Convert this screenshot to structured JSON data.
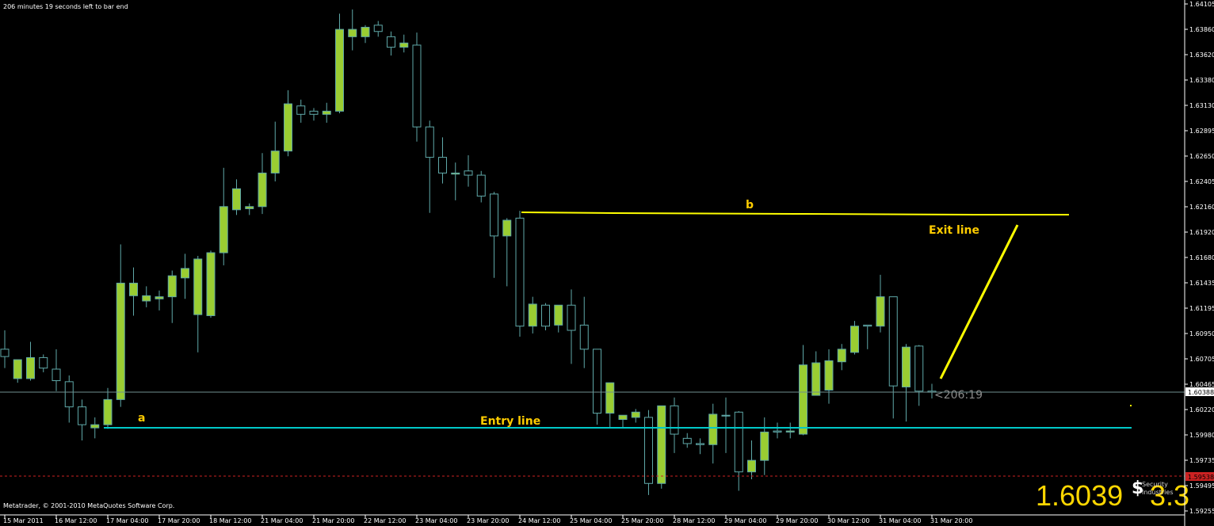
{
  "header": {
    "bar_timer": "206 minutes 19 seconds left to bar end"
  },
  "footer": {
    "copyright": "Metatrader, © 2001-2010 MetaQuotes Software Corp."
  },
  "colors": {
    "background": "#000000",
    "bull_fill": "#9acd32",
    "bear_fill": "#000000",
    "candle_outline": "#5fa8a8",
    "entry_line": "#00c8c8",
    "exit_line": "#ffff00",
    "annotation_text": "#ffcc00",
    "bid_line": "#6f8f8f",
    "lower_dashed": "#cc2222",
    "axis": "#ffffff"
  },
  "chart_data": {
    "type": "candlestick",
    "ylim": [
      1.5925,
      1.641
    ],
    "y_ticks": [
      "1.64105",
      "1.63860",
      "1.63620",
      "1.63380",
      "1.63130",
      "1.62895",
      "1.62650",
      "1.62405",
      "1.62160",
      "1.61920",
      "1.61680",
      "1.61435",
      "1.61195",
      "1.60950",
      "1.60705",
      "1.60465",
      "1.60220",
      "1.59980",
      "1.59735",
      "1.59495",
      "1.59255"
    ],
    "x_ticks": [
      {
        "label": "15 Mar 2011",
        "bar": 0
      },
      {
        "label": "16 Mar 12:00",
        "bar": 4
      },
      {
        "label": "17 Mar 04:00",
        "bar": 8
      },
      {
        "label": "17 Mar 20:00",
        "bar": 12
      },
      {
        "label": "18 Mar 12:00",
        "bar": 16
      },
      {
        "label": "21 Mar 04:00",
        "bar": 20
      },
      {
        "label": "21 Mar 20:00",
        "bar": 24
      },
      {
        "label": "22 Mar 12:00",
        "bar": 28
      },
      {
        "label": "23 Mar 04:00",
        "bar": 32
      },
      {
        "label": "23 Mar 20:00",
        "bar": 36
      },
      {
        "label": "24 Mar 12:00",
        "bar": 40
      },
      {
        "label": "25 Mar 04:00",
        "bar": 44
      },
      {
        "label": "25 Mar 20:00",
        "bar": 48
      },
      {
        "label": "28 Mar 12:00",
        "bar": 52
      },
      {
        "label": "29 Mar 04:00",
        "bar": 56
      },
      {
        "label": "29 Mar 20:00",
        "bar": 60
      },
      {
        "label": "30 Mar 12:00",
        "bar": 64
      },
      {
        "label": "31 Mar 04:00",
        "bar": 68
      },
      {
        "label": "31 Mar 20:00",
        "bar": 72
      }
    ],
    "ohlc": [
      [
        1.608,
        1.6098,
        1.6062,
        1.6073
      ],
      [
        1.6052,
        1.6068,
        1.6048,
        1.607
      ],
      [
        1.6052,
        1.6087,
        1.605,
        1.6072
      ],
      [
        1.6072,
        1.6075,
        1.6058,
        1.6062
      ],
      [
        1.6061,
        1.608,
        1.604,
        1.605
      ],
      [
        1.6049,
        1.6055,
        1.601,
        1.6025
      ],
      [
        1.6025,
        1.6032,
        1.5993,
        1.6008
      ],
      [
        1.6005,
        1.6015,
        1.5995,
        1.6008
      ],
      [
        1.6008,
        1.6043,
        1.6004,
        1.6032
      ],
      [
        1.6032,
        1.618,
        1.6025,
        1.6143
      ],
      [
        1.6131,
        1.6158,
        1.6112,
        1.6143
      ],
      [
        1.6126,
        1.614,
        1.612,
        1.6131
      ],
      [
        1.6128,
        1.6136,
        1.6117,
        1.613
      ],
      [
        1.613,
        1.6155,
        1.6105,
        1.615
      ],
      [
        1.6148,
        1.6171,
        1.6128,
        1.6157
      ],
      [
        1.6113,
        1.6169,
        1.6077,
        1.6166
      ],
      [
        1.6112,
        1.6174,
        1.611,
        1.6172
      ],
      [
        1.6172,
        1.6253,
        1.616,
        1.6216
      ],
      [
        1.6213,
        1.6242,
        1.6208,
        1.6233
      ],
      [
        1.6214,
        1.6219,
        1.6208,
        1.6216
      ],
      [
        1.6216,
        1.6267,
        1.6209,
        1.6248
      ],
      [
        1.6248,
        1.6297,
        1.624,
        1.6269
      ],
      [
        1.6269,
        1.6327,
        1.6264,
        1.6314
      ],
      [
        1.6312,
        1.6318,
        1.6296,
        1.6304
      ],
      [
        1.6307,
        1.631,
        1.6298,
        1.6304
      ],
      [
        1.6304,
        1.6315,
        1.6296,
        1.6307
      ],
      [
        1.6307,
        1.64,
        1.6305,
        1.6385
      ],
      [
        1.6378,
        1.6404,
        1.6365,
        1.6385
      ],
      [
        1.6378,
        1.6389,
        1.6372,
        1.6387
      ],
      [
        1.6389,
        1.6393,
        1.6378,
        1.6383
      ],
      [
        1.6378,
        1.6383,
        1.636,
        1.6368
      ],
      [
        1.6368,
        1.638,
        1.6363,
        1.6372
      ],
      [
        1.637,
        1.6382,
        1.6278,
        1.6292
      ],
      [
        1.6292,
        1.6298,
        1.621,
        1.6263
      ],
      [
        1.6263,
        1.6282,
        1.6238,
        1.6248
      ],
      [
        1.6247,
        1.6258,
        1.6222,
        1.6248
      ],
      [
        1.625,
        1.6265,
        1.6235,
        1.6246
      ],
      [
        1.6246,
        1.625,
        1.622,
        1.6226
      ],
      [
        1.6228,
        1.623,
        1.6148,
        1.6188
      ],
      [
        1.6188,
        1.6205,
        1.614,
        1.6203
      ],
      [
        1.6205,
        1.6212,
        1.6092,
        1.6102
      ],
      [
        1.6102,
        1.613,
        1.6095,
        1.6123
      ],
      [
        1.6122,
        1.6124,
        1.6098,
        1.6102
      ],
      [
        1.6103,
        1.612,
        1.6096,
        1.6122
      ],
      [
        1.6122,
        1.6137,
        1.6066,
        1.6098
      ],
      [
        1.6103,
        1.613,
        1.6062,
        1.608
      ],
      [
        1.608,
        1.608,
        1.6008,
        1.6019
      ],
      [
        1.6019,
        1.6046,
        1.6005,
        1.6048
      ],
      [
        1.6013,
        1.6015,
        1.6005,
        1.6017
      ],
      [
        1.6015,
        1.6023,
        1.601,
        1.602
      ],
      [
        1.6015,
        1.6022,
        1.5941,
        1.5952
      ],
      [
        1.5952,
        1.6026,
        1.5947,
        1.6026
      ],
      [
        1.6026,
        1.6034,
        1.5981,
        1.5999
      ],
      [
        1.5995,
        1.6,
        1.5986,
        1.599
      ],
      [
        1.599,
        1.5995,
        1.598,
        1.5989
      ],
      [
        1.5989,
        1.6028,
        1.5971,
        1.6018
      ],
      [
        1.6017,
        1.6034,
        1.5981,
        1.6017
      ],
      [
        1.602,
        1.6021,
        1.5945,
        1.5963
      ],
      [
        1.5963,
        1.5993,
        1.5956,
        1.5974
      ],
      [
        1.5974,
        1.6015,
        1.596,
        1.6001
      ],
      [
        1.6002,
        1.601,
        1.5995,
        1.6001
      ],
      [
        1.6001,
        1.601,
        1.5995,
        1.6002
      ],
      [
        1.5999,
        1.6084,
        1.5998,
        1.6065
      ],
      [
        1.6036,
        1.6078,
        1.6036,
        1.6067
      ],
      [
        1.6041,
        1.608,
        1.6028,
        1.6069
      ],
      [
        1.6068,
        1.6085,
        1.606,
        1.608
      ],
      [
        1.6077,
        1.6107,
        1.6075,
        1.6102
      ],
      [
        1.6103,
        1.6103,
        1.608,
        1.6102
      ],
      [
        1.6102,
        1.6151,
        1.6096,
        1.613
      ],
      [
        1.613,
        1.613,
        1.6014,
        1.6045
      ],
      [
        1.6044,
        1.6085,
        1.6011,
        1.6082
      ],
      [
        1.6083,
        1.6084,
        1.6026,
        1.604
      ],
      [
        1.604,
        1.6047,
        1.6033,
        1.6039
      ]
    ],
    "current_price": "1.60388",
    "price_marker_label": "<206:19",
    "red_level_label": "1.59538",
    "big_price_display": "1.6039",
    "big_spread_display": "3.3"
  },
  "annotations": {
    "point_a": "a",
    "point_b": "b",
    "entry_line_label": "Entry line",
    "exit_line_label": "Exit line"
  },
  "overlay_logo_text": "Security Industries"
}
